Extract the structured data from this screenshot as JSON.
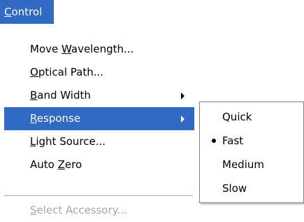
{
  "menubar": {
    "control": {
      "accel": "C",
      "rest": "ontrol"
    }
  },
  "menu": {
    "items": [
      {
        "pre": "Move ",
        "accel": "W",
        "post": "avelength..."
      },
      {
        "pre": "",
        "accel": "O",
        "post": "ptical Path..."
      },
      {
        "pre": "",
        "accel": "B",
        "post": "and Width"
      },
      {
        "pre": "",
        "accel": "R",
        "post": "esponse"
      },
      {
        "pre": "",
        "accel": "L",
        "post": "ight Source..."
      },
      {
        "pre": "Auto ",
        "accel": "Z",
        "post": "ero"
      },
      {
        "pre": "",
        "accel": "S",
        "post": "elect Accessory..."
      }
    ]
  },
  "submenu": {
    "items": [
      {
        "label": "Quick"
      },
      {
        "label": "Fast"
      },
      {
        "label": "Medium"
      },
      {
        "label": "Slow"
      }
    ]
  }
}
